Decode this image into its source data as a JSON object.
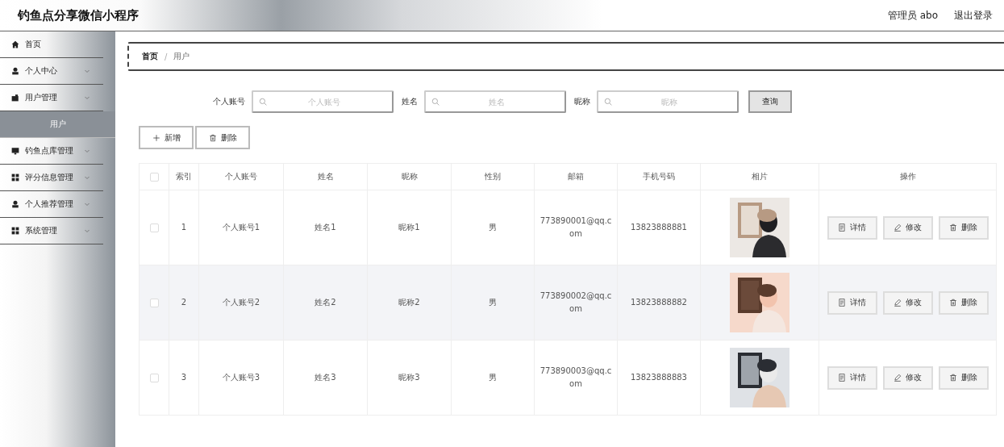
{
  "header": {
    "title": "钓鱼点分享微信小程序",
    "user": "管理员 abo",
    "logout": "退出登录"
  },
  "sidebar": {
    "items": [
      {
        "label": "首页",
        "kind": "home",
        "expandable": false,
        "selected": false
      },
      {
        "label": "个人中心",
        "kind": "person",
        "expandable": true,
        "selected": false
      },
      {
        "label": "用户管理",
        "kind": "wallet",
        "expandable": true,
        "selected": false,
        "children": [
          {
            "label": "用户",
            "selected": true
          }
        ]
      },
      {
        "label": "钓鱼点库管理",
        "kind": "monitor",
        "expandable": true,
        "selected": false
      },
      {
        "label": "评分信息管理",
        "kind": "grid",
        "expandable": true,
        "selected": false
      },
      {
        "label": "个人推荐管理",
        "kind": "person",
        "expandable": true,
        "selected": false
      },
      {
        "label": "系统管理",
        "kind": "grid",
        "expandable": true,
        "selected": false
      }
    ]
  },
  "breadcrumb": {
    "items": [
      "首页",
      "用户"
    ],
    "separator": "/"
  },
  "search": {
    "fields": [
      {
        "label": "个人账号",
        "placeholder": "个人账号"
      },
      {
        "label": "姓名",
        "placeholder": "姓名"
      },
      {
        "label": "昵称",
        "placeholder": "昵称"
      }
    ],
    "button": "查询"
  },
  "actions": [
    {
      "kind": "add",
      "label": "新增"
    },
    {
      "kind": "delete",
      "label": "删除"
    }
  ],
  "table": {
    "select_all_checked": false,
    "columns": [
      "索引",
      "个人账号",
      "姓名",
      "昵称",
      "性别",
      "邮箱",
      "手机号码",
      "相片",
      "操作"
    ],
    "rows": [
      {
        "checked": false,
        "index": "1",
        "account": "个人账号1",
        "name": "姓名1",
        "nickname": "昵称1",
        "gender": "男",
        "email": "773890001@qq.com",
        "phone": "13823888881",
        "actions": [
          {
            "kind": "detail",
            "label": "详情"
          },
          {
            "kind": "edit",
            "label": "修改"
          },
          {
            "kind": "delete",
            "label": "删除"
          }
        ]
      },
      {
        "checked": false,
        "index": "2",
        "account": "个人账号2",
        "name": "姓名2",
        "nickname": "昵称2",
        "gender": "男",
        "email": "773890002@qq.com",
        "phone": "13823888882",
        "actions": [
          {
            "kind": "detail",
            "label": "详情"
          },
          {
            "kind": "edit",
            "label": "修改"
          },
          {
            "kind": "delete",
            "label": "删除"
          }
        ]
      },
      {
        "checked": false,
        "index": "3",
        "account": "个人账号3",
        "name": "姓名3",
        "nickname": "昵称3",
        "gender": "男",
        "email": "773890003@qq.com",
        "phone": "13823888883",
        "actions": [
          {
            "kind": "detail",
            "label": "详情"
          },
          {
            "kind": "edit",
            "label": "修改"
          },
          {
            "kind": "delete",
            "label": "删除"
          }
        ]
      }
    ]
  }
}
